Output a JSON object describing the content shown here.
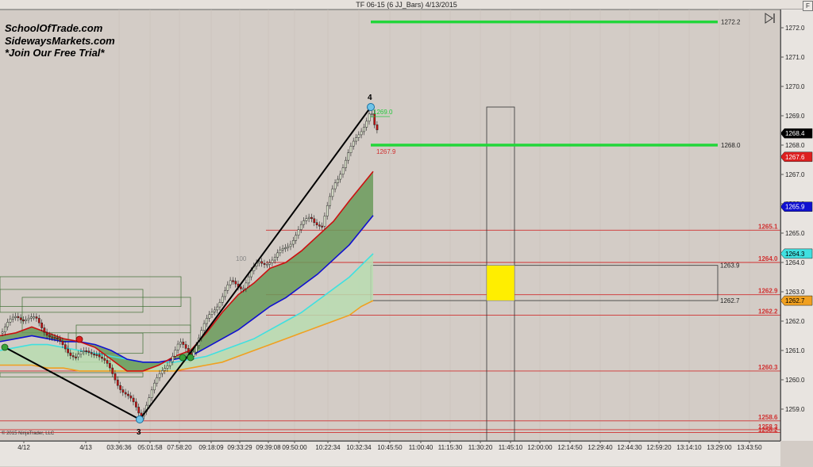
{
  "window": {
    "title": "TF 06-15 (6 JJ_Bars)  4/13/2015",
    "f_button": "F",
    "copyright": "© 2015 NinjaTrader, LLC"
  },
  "branding": {
    "line1": "SchoolOfTrade.com",
    "line2": "SidewaysMarkets.com",
    "line3": "*Join Our Free Trial*"
  },
  "icons": {
    "scroll_end": "scroll-to-end-icon"
  },
  "colors": {
    "background": "#d3ccc6",
    "green_level": "#22d63a",
    "red_level": "#d03030",
    "ema_fast": "#cc1010",
    "ema_slow": "#1010d0",
    "ema_cyan": "#40e0e0",
    "ema_orange": "#f0a020",
    "ribbon_dark": "#6a9a5a",
    "ribbon_light": "#b8dcb0",
    "candle_up": "#e8f0d8",
    "candle_down": "#cc1010",
    "zone_yellow": "#ffee00"
  },
  "price_axis": {
    "ticks": [
      "1272.0",
      "1271.0",
      "1270.0",
      "1269.0",
      "1268.0",
      "1267.0",
      "1266.0",
      "1265.0",
      "1264.0",
      "1263.0",
      "1262.0",
      "1261.0",
      "1260.0",
      "1259.0"
    ],
    "markers": [
      {
        "label": "1268.4",
        "bg": "#000000",
        "fg": "#ffffff",
        "price": 1268.4
      },
      {
        "label": "1267.6",
        "bg": "#dd2020",
        "fg": "#ffffff",
        "price": 1267.6
      },
      {
        "label": "1265.9",
        "bg": "#1010d0",
        "fg": "#ffffff",
        "price": 1265.9
      },
      {
        "label": "1264.3",
        "bg": "#40e0e0",
        "fg": "#000000",
        "price": 1264.3
      },
      {
        "label": "1262.7",
        "bg": "#f0a020",
        "fg": "#000000",
        "price": 1262.7
      }
    ]
  },
  "time_axis": {
    "labels": [
      "4/12",
      "4/13",
      "03:36:36",
      "05:01:58",
      "07:58:20",
      "09:18:09",
      "09:33:29",
      "09:39:08",
      "09:50:00",
      "10:22:34",
      "10:32:34",
      "10:45:50",
      "11:00:40",
      "11:15:30",
      "11:30:20",
      "11:45:10",
      "12:00:00",
      "12:14:50",
      "12:29:40",
      "12:44:30",
      "12:59:20",
      "13:14:10",
      "13:29:00",
      "13:43:50"
    ]
  },
  "chart_data": {
    "type": "candlestick",
    "title": "TF 06-15 (6 JJ_Bars)  4/13/2015",
    "ylim": [
      1258.35,
      1272.6
    ],
    "green_levels": [
      {
        "label": "1272.2",
        "price": 1272.2
      },
      {
        "label": "1268.0",
        "price": 1268.0
      }
    ],
    "red_levels": [
      {
        "label": "1265.1",
        "price": 1265.1
      },
      {
        "label": "1264.0",
        "price": 1264.0
      },
      {
        "label": "1262.9",
        "price": 1262.9
      },
      {
        "label": "1262.2",
        "price": 1262.2
      },
      {
        "label": "1260.3",
        "price": 1260.3
      },
      {
        "label": "1258.6",
        "price": 1258.6
      },
      {
        "label": "1258.3",
        "price": 1258.3
      },
      {
        "label": "1258.2",
        "price": 1258.2
      }
    ],
    "zone_labels": [
      {
        "label": "1263.9",
        "price": 1263.9
      },
      {
        "label": "1262.7",
        "price": 1262.7
      }
    ],
    "swing_labels": [
      {
        "label": "3",
        "price": 1258.75
      },
      {
        "label": "4",
        "price": 1269.3
      }
    ],
    "annotations": [
      {
        "label": "1269.0",
        "price": 1269.0
      },
      {
        "label": "1267.9",
        "price": 1267.9
      },
      {
        "label": "100",
        "price": 1264.1
      }
    ]
  }
}
